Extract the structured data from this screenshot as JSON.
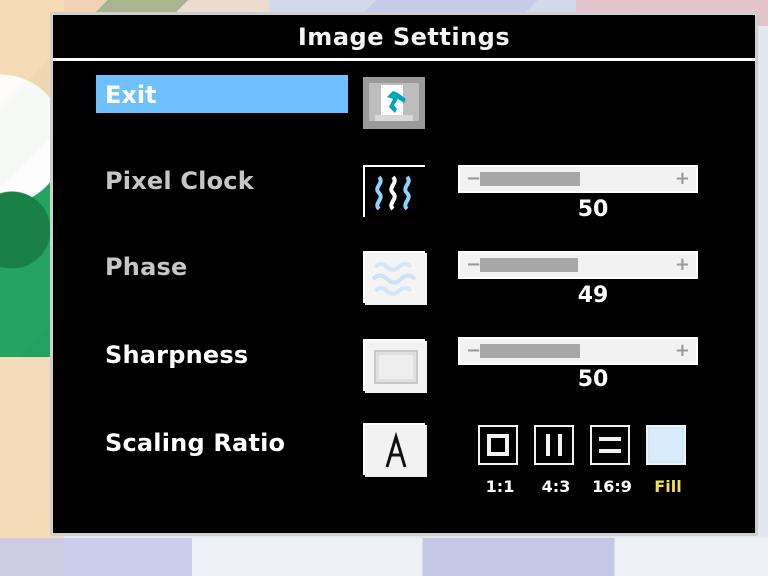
{
  "osd": {
    "title": "Image Settings",
    "items": [
      {
        "label": "Exit"
      },
      {
        "label": "Pixel Clock",
        "value": 50
      },
      {
        "label": "Phase",
        "value": 49
      },
      {
        "label": "Sharpness",
        "value": 50
      },
      {
        "label": "Scaling Ratio"
      }
    ],
    "slider_symbols": {
      "minus": "−",
      "plus": "+"
    },
    "scaling_options": [
      "1:1",
      "4:3",
      "16:9",
      "Fill"
    ],
    "scaling_selected": "Fill",
    "icons": {
      "exit": "exit-door-icon",
      "pixel_clock": "wavy-lines-icon",
      "phase": "noise-pattern-icon",
      "sharpness": "sharpness-icon",
      "scaling": "letter-a-icon",
      "ratio_1_1": "square-ratio-icon",
      "ratio_4_3": "bars-ratio-icon",
      "ratio_16_9": "widescreen-ratio-icon",
      "ratio_fill": "fill-ratio-icon"
    },
    "colors": {
      "panel_bg": "#000000",
      "panel_border": "#cfcfcf",
      "selection_bar": "#6fc0ff",
      "slider_fill": "#a7a7a7",
      "selected_option": "#f3e14a"
    }
  }
}
